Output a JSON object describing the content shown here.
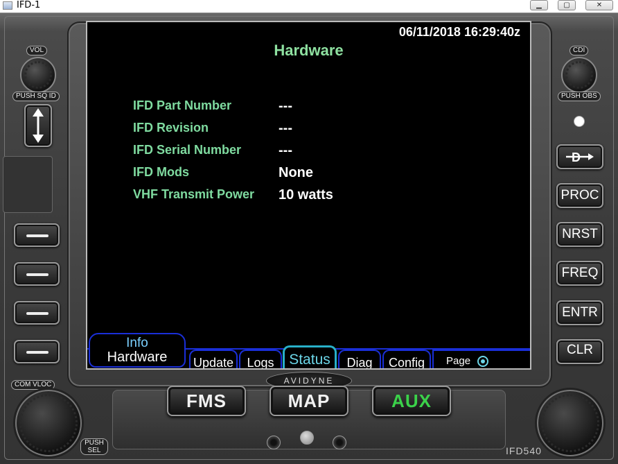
{
  "window": {
    "title": "IFD-1",
    "minimize": "▁",
    "maximize": "▢",
    "close": "✕"
  },
  "screen": {
    "datetime": "06/11/2018 16:29:40z",
    "title": "Hardware",
    "rows": [
      {
        "label": "IFD Part Number",
        "value": "---"
      },
      {
        "label": "IFD Revision",
        "value": "---"
      },
      {
        "label": "IFD Serial Number",
        "value": "---"
      },
      {
        "label": "IFD Mods",
        "value": "None"
      },
      {
        "label": "VHF Transmit Power",
        "value": "10 watts"
      }
    ],
    "tab_group": {
      "group": "Info",
      "current": "Hardware"
    },
    "tabs": [
      "Update",
      "Logs",
      "Status",
      "Diag",
      "Config"
    ],
    "active_tab": "Status",
    "page_label": "Page"
  },
  "bezel": {
    "vol_label": "VOL",
    "push_sq_id": "PUSH SQ ID",
    "cdi_label": "CDI",
    "push_obs": "PUSH OBS",
    "com_vloc": "COM VLOC",
    "push_sel": "PUSH SEL",
    "right_keys": [
      "PROC",
      "NRST",
      "FREQ",
      "ENTR",
      "CLR"
    ],
    "direct_to_icon": "direct-to-icon",
    "bottom_keys": [
      "FMS",
      "MAP",
      "AUX"
    ],
    "brand": "AVIDYNE",
    "model": "IFD540",
    "aux_color": "#3bd24a",
    "label_color": "#7fdba0",
    "tab_border_color": "#1a2fd8",
    "active_tab_color": "#6cd6e8"
  }
}
